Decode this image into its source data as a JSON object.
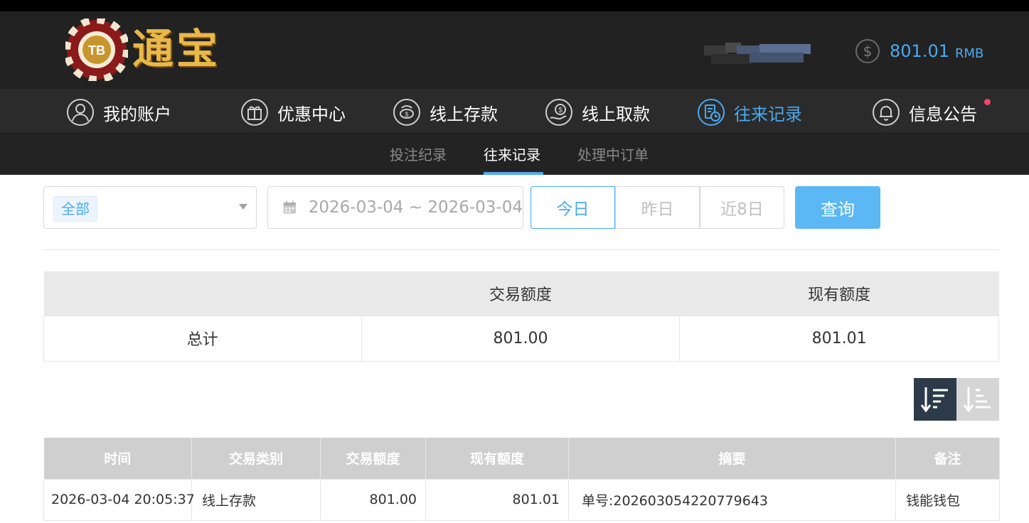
{
  "brand": {
    "logo_text": "通宝",
    "chip_text": "TB"
  },
  "account": {
    "balance": "801.01",
    "currency": "RMB"
  },
  "main_nav": [
    {
      "label": "我的账户",
      "icon": "user-icon",
      "active": false
    },
    {
      "label": "优惠中心",
      "icon": "gift-icon",
      "active": false
    },
    {
      "label": "线上存款",
      "icon": "deposit-icon",
      "active": false
    },
    {
      "label": "线上取款",
      "icon": "withdraw-icon",
      "active": false
    },
    {
      "label": "往来记录",
      "icon": "records-icon",
      "active": true
    },
    {
      "label": "信息公告",
      "icon": "bell-icon",
      "active": false,
      "has_notification": true
    }
  ],
  "sub_nav": [
    {
      "label": "投注纪录",
      "active": false
    },
    {
      "label": "往来记录",
      "active": true
    },
    {
      "label": "处理中订单",
      "active": false
    }
  ],
  "filters": {
    "type_selected": "全部",
    "date_range": "2026-03-04 ~ 2026-03-04",
    "ranges": [
      "今日",
      "昨日",
      "近8日"
    ],
    "active_range": "今日",
    "query_label": "查询"
  },
  "summary": {
    "headers": [
      "",
      "交易额度",
      "现有额度"
    ],
    "row": [
      "总计",
      "801.00",
      "801.01"
    ]
  },
  "sort": {
    "options": [
      "descending",
      "ascending"
    ],
    "active": "descending"
  },
  "records": {
    "headers": [
      "时间",
      "交易类别",
      "交易额度",
      "现有额度",
      "摘要",
      "备注"
    ],
    "rows": [
      [
        "2026-03-04 20:05:37",
        "线上存款",
        "801.00",
        "801.01",
        "单号:202603054220779643",
        "钱能钱包"
      ]
    ]
  },
  "colors": {
    "accent": "#4aa9f0",
    "header_bg": "#222222",
    "nav_bg": "#2b2b2b",
    "query_button": "#5bb8f5",
    "notification_dot": "#ef4a6b"
  }
}
